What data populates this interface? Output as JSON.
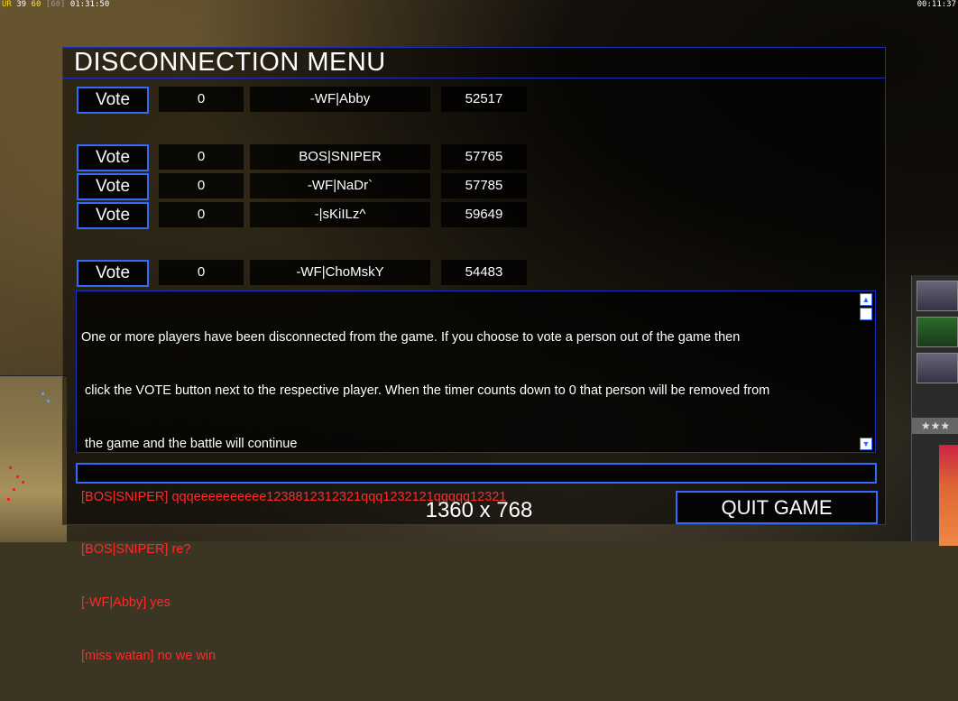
{
  "hud": {
    "top_left_prefix": "UR",
    "top_left_num1": "39",
    "top_left_num2": "60",
    "top_left_num3": "[60]",
    "top_left_time": "01:31:50",
    "top_right_time": "00:11:37",
    "rank_stars": "★★★"
  },
  "dialog": {
    "title": "DISCONNECTION MENU",
    "vote_label": "Vote",
    "players": [
      {
        "votes": "0",
        "name": "-WF|Abby",
        "ping": "52517"
      },
      {
        "votes": "0",
        "name": "BOS|SNIPER",
        "ping": "57765"
      },
      {
        "votes": "0",
        "name": "-WF|NaDr`",
        "ping": "57785"
      },
      {
        "votes": "0",
        "name": "-|sKiILz^",
        "ping": "59649"
      },
      {
        "votes": "0",
        "name": "-WF|ChoMskY",
        "ping": "54483"
      }
    ],
    "info_lines": [
      "One or more players have been disconnected from the game. If you choose to vote a person out of the game then",
      " click the VOTE button next to the respective player. When the timer counts down to 0 that person will be removed from",
      " the game and the battle will continue"
    ],
    "chat_messages": [
      "[BOS|SNIPER] qqqeeeeeeeeee1238812312321qqq1232121qqqqq12321",
      "[BOS|SNIPER] re?",
      "[-WF|Abby] yes",
      "[miss watan] no we win"
    ],
    "chat_input_value": "",
    "resolution": "1360 x 768",
    "quit_label": "QUIT GAME"
  },
  "colors": {
    "accent_blue": "#2f6bff",
    "border_blue": "#1c2fbf",
    "chat_red": "#ff2a2a"
  }
}
